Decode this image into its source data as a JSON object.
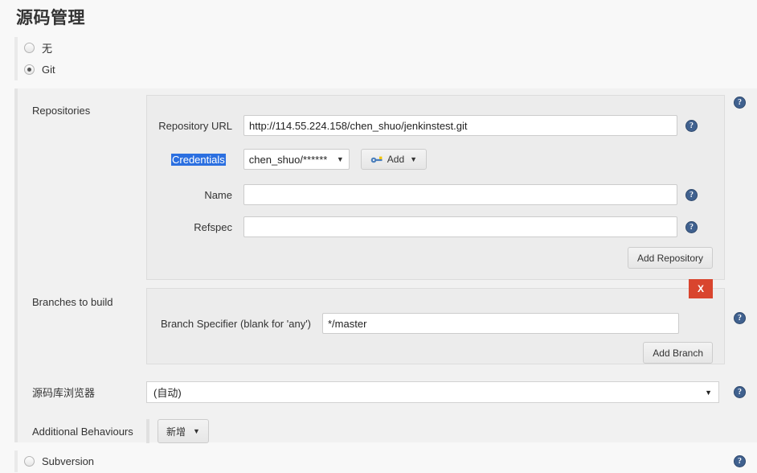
{
  "page": {
    "title": "源码管理"
  },
  "scm_options": [
    {
      "label": "无",
      "selected": false,
      "name": "none"
    },
    {
      "label": "Git",
      "selected": true,
      "name": "git"
    }
  ],
  "git": {
    "repositories": {
      "section_label": "Repositories",
      "url": {
        "label": "Repository URL",
        "value": "http://114.55.224.158/chen_shuo/jenkinstest.git",
        "placeholder": ""
      },
      "credentials": {
        "label": "Credentials",
        "selected": "chen_shuo/******",
        "add_button": "Add",
        "add_icon": "key-icon",
        "highlighted": true
      },
      "name": {
        "label": "Name",
        "value": "",
        "placeholder": ""
      },
      "refspec": {
        "label": "Refspec",
        "value": "",
        "placeholder": ""
      },
      "add_repository_button": "Add Repository"
    },
    "branches": {
      "section_label": "Branches to build",
      "specifier": {
        "label": "Branch Specifier (blank for 'any')",
        "value": "*/master",
        "placeholder": ""
      },
      "delete_button": "X",
      "add_branch_button": "Add Branch"
    },
    "repository_browser": {
      "label": "源码库浏览器",
      "selected": "(自动)"
    },
    "additional_behaviours": {
      "label": "Additional Behaviours",
      "add_button": "新增"
    }
  },
  "subversion": {
    "label": "Subversion",
    "selected": false
  },
  "icons": {
    "help": "?",
    "caret_down": "▼"
  },
  "colors": {
    "delete_red": "#d9452e",
    "help_blue": "#40618f",
    "selection_blue": "#2b6fe0",
    "panel_bg": "#f1f1f1",
    "block_bg": "#ececec"
  }
}
